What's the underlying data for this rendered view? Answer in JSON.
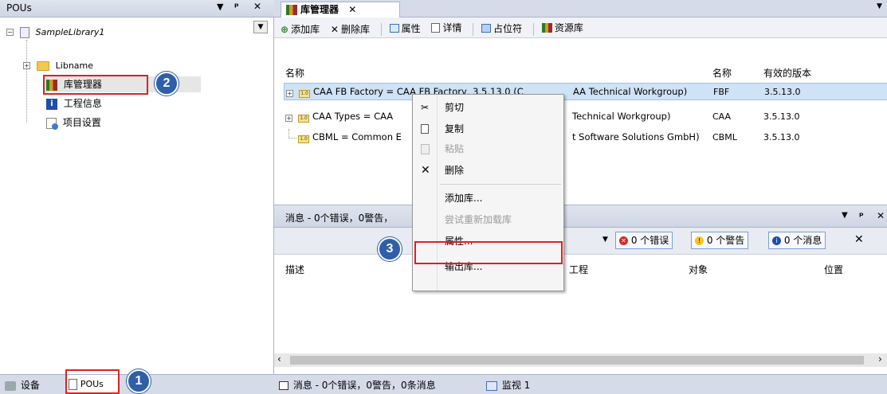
{
  "left_panel": {
    "title": "POUs",
    "header_controls": [
      "▾",
      "ᵖ",
      "✕"
    ],
    "library_dropdown": "SampleLibrary1",
    "tree": {
      "root": "SampleLibrary1",
      "items": [
        {
          "label": "Libname"
        },
        {
          "label": "库管理器"
        },
        {
          "label": "工程信息"
        },
        {
          "label": "项目设置"
        }
      ]
    },
    "bottom_tabs": [
      {
        "label": "设备"
      },
      {
        "label": "POUs"
      }
    ]
  },
  "editor": {
    "tab_label": "库管理器",
    "tab_close": "✕",
    "toolbar": {
      "add": "添加库",
      "delete": "删除库",
      "properties": "属性",
      "details": "详情",
      "placeholder": "占位符",
      "repository": "资源库"
    },
    "columns": {
      "name": "名称",
      "ns": "名称",
      "version": "有效的版本"
    },
    "rows": [
      {
        "name": "CAA FB Factory = CAA FB Factory, 3.5.13.0 (CAA Technical Workgroup)",
        "ns": "FBF",
        "version": "3.5.13.0"
      },
      {
        "name": "CAA Types = CAA Types Extern, 3.5.13.0 (CAA Technical Workgroup)",
        "ns": "CAA",
        "version": "3.5.13.0"
      },
      {
        "name": "CBML = Common Behaviour Model, 3.5.13.0 (3S - Smart Software Solutions GmbH)",
        "ns": "CBML",
        "version": "3.5.13.0"
      }
    ],
    "rows_visible": [
      {
        "left": "CAA FB Factory = CAA FB Factory, 3.5.13.0 (C",
        "right": "AA Technical Workgroup)"
      },
      {
        "left": "CAA Types = CAA",
        "right": "Technical Workgroup)"
      },
      {
        "left": "CBML = Common E",
        "right": "t Software Solutions GmbH)"
      }
    ]
  },
  "messages": {
    "title": "消息 - 0个错误，0警告，",
    "errors": "0 个错误",
    "warnings": "0 个警告",
    "infos": "0 个消息",
    "columns": {
      "description": "描述",
      "project": "工程",
      "object": "对象",
      "position": "位置"
    }
  },
  "context_menu": {
    "items": [
      {
        "label": "剪切",
        "icon": "scissors-icon",
        "enabled": true
      },
      {
        "label": "复制",
        "icon": "copy-icon",
        "enabled": true
      },
      {
        "label": "粘贴",
        "icon": "paste-icon",
        "enabled": false
      },
      {
        "label": "删除",
        "icon": "delete-icon",
        "enabled": true
      },
      {
        "label": "添加库...",
        "enabled": true
      },
      {
        "label": "尝试重新加载库",
        "enabled": false
      },
      {
        "label": "属性...",
        "enabled": true,
        "highlighted_box": true
      },
      {
        "label": "输出库...",
        "enabled": true
      }
    ]
  },
  "statusbar": {
    "messages_tab": "消息 - 0个错误，0警告，0条消息",
    "watch_tab": "监视 1"
  },
  "callouts": {
    "one": "1",
    "two": "2",
    "three": "3"
  },
  "colors": {
    "accent_badge": "#2f5fa8",
    "highlight": "#e02020",
    "selection": "#cfe3f7"
  }
}
